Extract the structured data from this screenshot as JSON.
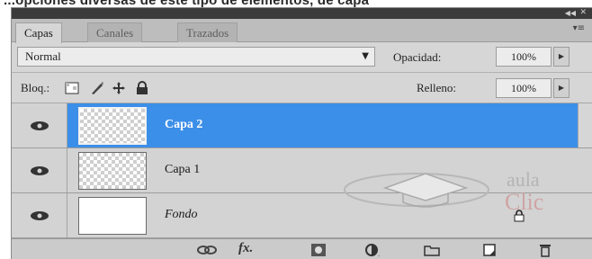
{
  "caption": "...opciones diversas de este tipo de elementos, de capa",
  "tabs": [
    {
      "label": "Capas",
      "active": true
    },
    {
      "label": "Canales",
      "active": false
    },
    {
      "label": "Trazados",
      "active": false
    }
  ],
  "panel_menu_icon": "panel-menu-icon",
  "blend_mode": "Normal",
  "opacity": {
    "label": "Opacidad:",
    "value": "100%"
  },
  "lock": {
    "label": "Bloq.:",
    "icons": [
      "lock-transparent-pixels-icon",
      "lock-image-pixels-icon",
      "lock-position-icon",
      "lock-all-icon"
    ]
  },
  "fill": {
    "label": "Relleno:",
    "value": "100%"
  },
  "layers": [
    {
      "name": "Capa 2",
      "selected": true,
      "thumb": "transparent",
      "italic": false,
      "locked": false
    },
    {
      "name": "Capa 1",
      "selected": false,
      "thumb": "transparent",
      "italic": false,
      "locked": false
    },
    {
      "name": "Fondo",
      "selected": false,
      "thumb": "white",
      "italic": true,
      "locked": true
    }
  ],
  "watermark": {
    "line1": "aula",
    "line2": "Clic"
  },
  "bottom_icons": [
    "link-layers-icon",
    "layer-style-fx-icon",
    "add-mask-icon",
    "adjustment-layer-icon",
    "new-group-icon",
    "new-layer-icon",
    "delete-layer-icon"
  ],
  "colors": {
    "selection": "#3c8fe8",
    "panel_bg": "#d6d6d6",
    "titlebar": "#3b3b3b"
  }
}
